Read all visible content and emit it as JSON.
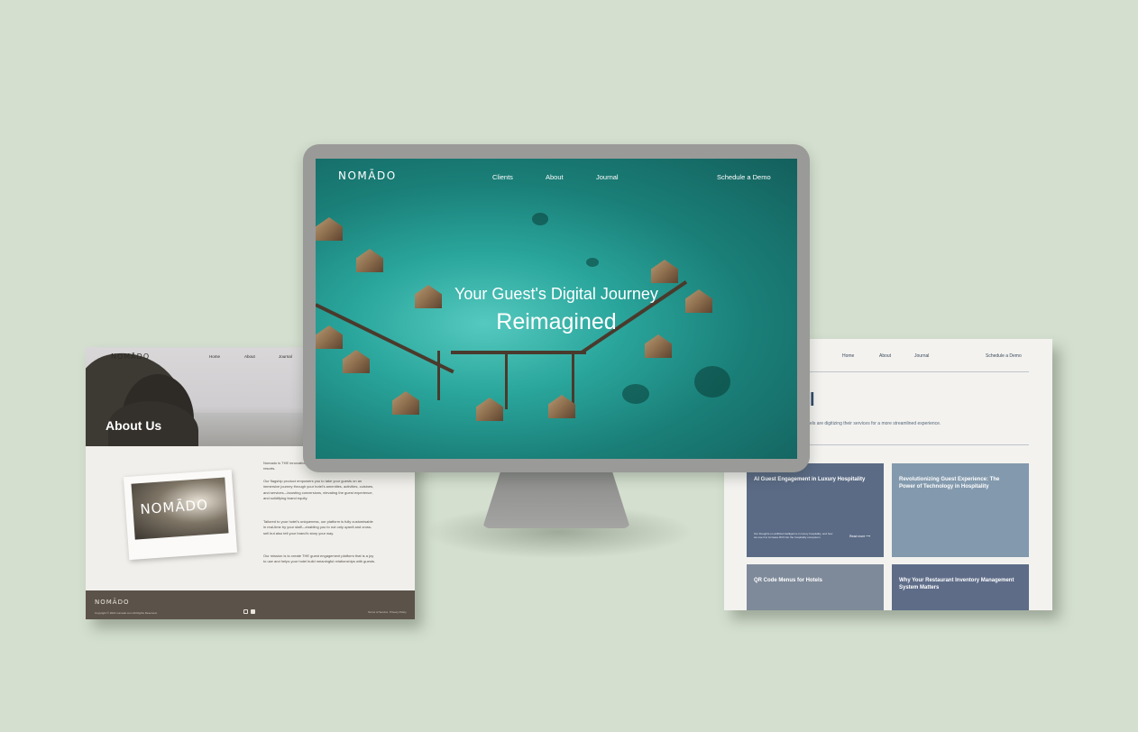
{
  "about_page": {
    "logo": "NOMĀDO",
    "nav": [
      "Home",
      "About",
      "Journal"
    ],
    "title": "About Us",
    "polaroid_logo": "NOMĀDO",
    "paragraphs": [
      "Nomado is THE innovative guest engagement platform for hotels and resorts.",
      "Our flagship product empowers you to take your guests on an immersive journey through your hotel's amenities, activities, cuisines, and services—boosting conversions, elevating the guest experience, and solidifying brand equity.",
      "Tailored to your hotel's uniqueness, our platform is fully customisable in real-time by your staff—enabling you to not only upsell and cross-sell but also tell your brand's story your way.",
      "Our mission is to create THE guest engagement platform that is a joy to use and helps your hotel build meaningful relationships with guests."
    ],
    "footer": {
      "logo": "NOMĀDO",
      "copyright": "Copyright © 2024 nomado.com All Rights Reserved.",
      "links": [
        "Terms of Service",
        "Privacy Policy"
      ],
      "social_icons": [
        "instagram-icon",
        "linkedin-icon"
      ]
    }
  },
  "monitor_page": {
    "logo": "NOMĀDO",
    "nav": [
      "Clients",
      "About",
      "Journal"
    ],
    "cta": "Schedule a Demo",
    "headline": "Your Guest's Digital Journey",
    "subheadline": "Reimagined"
  },
  "journal_page": {
    "nav": [
      "Home",
      "About",
      "Journal"
    ],
    "cta": "Schedule a Demo",
    "heading": "l",
    "subtitle": "els are digitizing their services for a more streamlined experience.",
    "cards": [
      {
        "title": "AI Guest Engagement in Luxury Hospitality",
        "desc": "Our thoughts on artificial intelligence in luxury hospitality, and how we use it to increase ROI into the hospitality ecosystem.",
        "more": "Read more ⟶",
        "color": "#5b6b86"
      },
      {
        "title": "Revolutionizing Guest Experience: The Power of Technology in Hospitality",
        "desc": "",
        "more": "",
        "color": "#8399ad"
      },
      {
        "title": "QR Code Menus for Hotels",
        "desc": "",
        "more": "",
        "color": "#7e8a9a"
      },
      {
        "title": "Why Your Restaurant Inventory Management System Matters",
        "desc": "",
        "more": "",
        "color": "#5e6c88"
      }
    ]
  }
}
